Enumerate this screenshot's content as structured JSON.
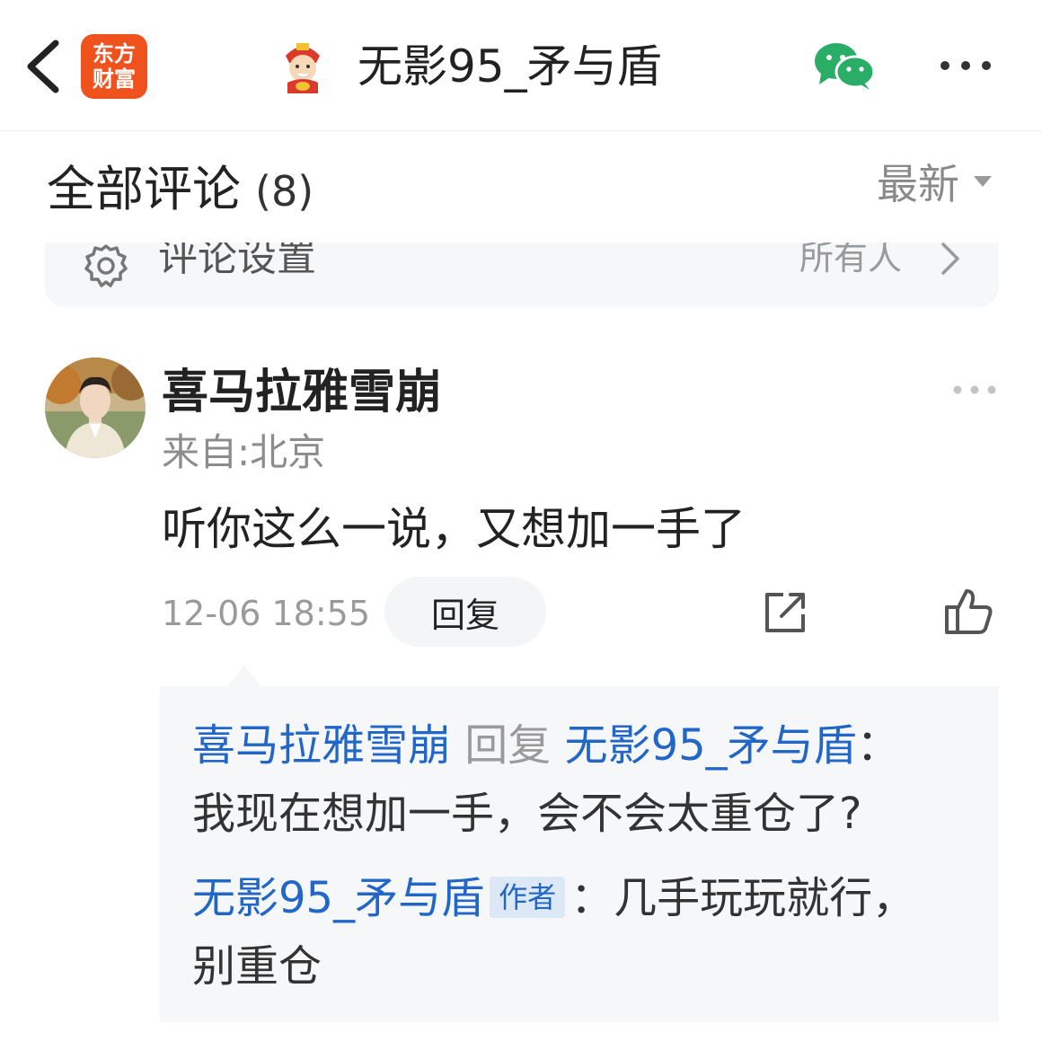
{
  "header": {
    "logo_line1": "东方",
    "logo_line2": "财富",
    "title": "无影95_矛与盾",
    "icons": [
      "back-icon",
      "mascot-icon",
      "wechat-icon",
      "more-icon"
    ]
  },
  "section": {
    "title": "全部评论",
    "count": "(8)",
    "sort_label": "最新"
  },
  "settings": {
    "label": "评论设置",
    "value": "所有人"
  },
  "comment": {
    "username": "喜马拉雅雪崩",
    "location": "来自:北京",
    "text": "听你这么一说，又想加一手了",
    "time": "12-06 18:55",
    "reply_label": "回复"
  },
  "replies": [
    {
      "from": "喜马拉雅雪崩",
      "verb": "回复",
      "to": "无影95_矛与盾",
      "colon": "：",
      "text": "我现在想加一手，会不会太重仓了?"
    },
    {
      "from": "无影95_矛与盾",
      "tag": "作者",
      "colon": "：",
      "text_line1": "几手玩玩就行，",
      "text_line2": "别重仓"
    }
  ],
  "colors": {
    "brand": "#f0521e",
    "link_blue": "#2266c8",
    "wechat_green": "#2aae67",
    "panel_bg": "#f6f7f9"
  }
}
